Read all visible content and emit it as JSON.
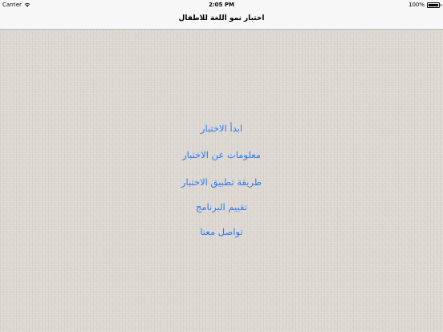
{
  "status_bar": {
    "carrier": "Carrier",
    "time": "2:05 PM",
    "battery_text": "100%",
    "battery_level": 1.0,
    "wifi_icon": "wifi-icon",
    "battery_icon": "battery-icon"
  },
  "nav": {
    "title": "اختبار نمو اللغة للاطفال"
  },
  "menu": {
    "items": [
      {
        "label": "ابدأ الاختبار"
      },
      {
        "label": "معلومات عن الاختبار"
      },
      {
        "label": "طريقة تطبيق الاختبار"
      },
      {
        "label": "تقييم البرنامج"
      },
      {
        "label": "تواصل معنا"
      }
    ],
    "link_color": "#2e7cf6"
  },
  "colors": {
    "background": "#ddd7d2",
    "bar_background": "#f7f7f7"
  }
}
